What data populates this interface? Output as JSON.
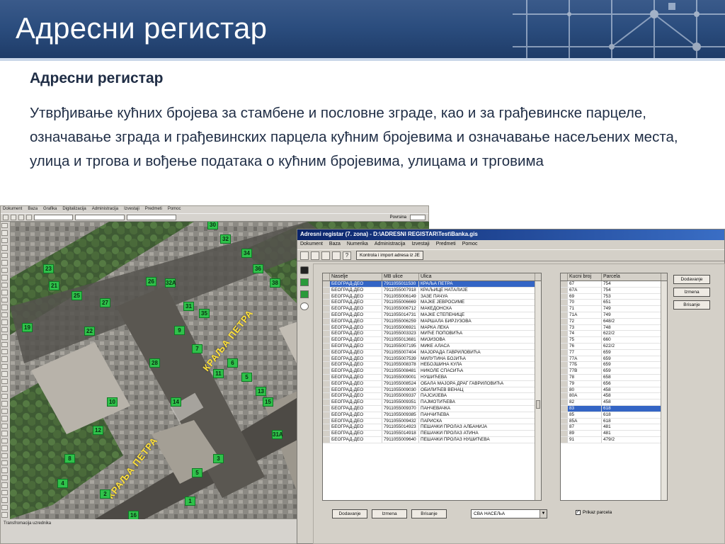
{
  "slide": {
    "title": "Адресни регистар",
    "subheading": "Адресни регистар",
    "body": "Утврђивање кућних бројева за стамбене и пословне зграде, као и за грађевинске парцеле, означавање зграда и грађевинских парцела кућним бројевима и означавање насељених места, улица и тргова и вођење података о кућним бројевима, улицама и трговима"
  },
  "colors": {
    "banner": "#2b4d7e",
    "text": "#1f2d45",
    "building_marker": "#2fc14a",
    "street_label": "#ffe13a",
    "selection": "#3465c5"
  },
  "map_app": {
    "menu": [
      "Dokument",
      "Baza",
      "Grafika",
      "Digitalizacija",
      "Administracija",
      "Izvestaji",
      "Predmeti",
      "Pomoc"
    ],
    "status_text": "Transfromacija uzrednika",
    "zoom_label": "Povrsina",
    "street_labels": [
      "КРАЉА ПЕТРА",
      "КРАЉА ПЕТРА"
    ],
    "building_numbers": [
      "30",
      "32",
      "34",
      "36",
      "38",
      "26",
      "42",
      "44",
      "23",
      "21",
      "25",
      "27",
      "19",
      "22",
      "32A",
      "28",
      "35",
      "31",
      "9",
      "7",
      "6",
      "11",
      "5",
      "13",
      "15",
      "31A",
      "14",
      "3",
      "5",
      "1",
      "10",
      "12",
      "8",
      "4",
      "2",
      "16"
    ]
  },
  "register": {
    "window_title": "Adresni registar (7. zona) - D:\\ADRESNI REGISTAR\\Test\\Banka.gis",
    "menu": [
      "Dokument",
      "Baza",
      "Numerika",
      "Administracija",
      "Izvestaji",
      "Predmeti",
      "Pomoc"
    ],
    "toolbar_button": "Kontrola i import adresa iz JE",
    "streets_table": {
      "headers": [
        "Naselje",
        "MB ulice",
        "Ulica"
      ],
      "selected_index": 0,
      "rows": [
        [
          "БЕОГРАД-ДЕО",
          "7911055011530",
          "КРАЉА ПЕТРА"
        ],
        [
          "БЕОГРАД-ДЕО",
          "7911055007918",
          "КРАЉИЦЕ НАТАЛИЈЕ"
        ],
        [
          "БЕОГРАД-ДЕО",
          "7911055006149",
          "ЗАЗЕ ПАЧУА"
        ],
        [
          "БЕОГРАД-ДЕО",
          "7911055006669",
          "МАЈКЕ ЈЕВРОСИМЕ"
        ],
        [
          "БЕОГРАД-ДЕО",
          "7911055006712",
          "МАКЕДОНСКА"
        ],
        [
          "БЕОГРАД-ДЕО",
          "7911055014731",
          "МАЈКЕ СТЕПЕНИЦЕ"
        ],
        [
          "БЕОГРАД-ДЕО",
          "7911055006259",
          "МАРШАЛА БИРЈУЗОВА"
        ],
        [
          "БЕОГРАД-ДЕО",
          "7911055006921",
          "МАРКА ЛЕКА"
        ],
        [
          "БЕОГРАД-ДЕО",
          "7911055003323",
          "МИЋЕ ПОПОВИЋА"
        ],
        [
          "БЕОГРАД-ДЕО",
          "7911055013681",
          "МИЈИЗОВА"
        ],
        [
          "БЕОГРАД-ДЕО",
          "7911055007195",
          "МИКЕ АЛАСА"
        ],
        [
          "БЕОГРАД-ДЕО",
          "7911055007404",
          "МАЈОРАДА ГАВРИЛОВИЋА"
        ],
        [
          "БЕОГРАД-ДЕО",
          "7911055007539",
          "МИЛУТИНА БОЈИЋА"
        ],
        [
          "БЕОГРАД-ДЕО",
          "7911055008378",
          "НЕБОЈШИНА КУЛА"
        ],
        [
          "БЕОГРАД-ДЕО",
          "7911055008481",
          "НИКОЛЕ СПАСИЋА"
        ],
        [
          "БЕОГРАД-ДЕО",
          "7911055009001",
          "НУШИЋЕВА"
        ],
        [
          "БЕОГРАД-ДЕО",
          "7911055008524",
          "ОБАЛА МАЈОРА ДРАГ ГАВРИЛОВИЋА"
        ],
        [
          "БЕОГРАД-ДЕО",
          "7911055009030",
          "ОБИЛИЋЕВ ВЕНАЦ"
        ],
        [
          "БЕОГРАД-ДЕО",
          "7911055009337",
          "ПАЈСИЈЕВА"
        ],
        [
          "БЕОГРАД-ДЕО",
          "7911055009351",
          "ПАЈМОТИЋЕВА"
        ],
        [
          "БЕОГРАД-ДЕО",
          "7911055009370",
          "ПАНЧЕВАЧКА"
        ],
        [
          "БЕОГРАД-ДЕО",
          "7911055009385",
          "ПАНЧИЋЕВА"
        ],
        [
          "БЕОГРАД-ДЕО",
          "7911055009432",
          "ПАРИСКА"
        ],
        [
          "БЕОГРАД-ДЕО",
          "7911055014923",
          "ПЕШАЧКИ ПРОЛАЗ АЛБАНИЈА"
        ],
        [
          "БЕОГРАД-ДЕО",
          "7911055014918",
          "ПЕШАЧКИ ПРОЛАЗ АТИНА"
        ],
        [
          "БЕОГРАД-ДЕО",
          "7911055009640",
          "ПЕШАЧКИ ПРОЛАЗ НУШИЋЕВА"
        ]
      ]
    },
    "numbers_table": {
      "headers": [
        "Kucni broj",
        "Parcela"
      ],
      "selected_index": 20,
      "rows": [
        [
          "67",
          "754"
        ],
        [
          "67A",
          "754"
        ],
        [
          "69",
          "753"
        ],
        [
          "70",
          "651"
        ],
        [
          "71",
          "749"
        ],
        [
          "71A",
          "749"
        ],
        [
          "72",
          "648/2"
        ],
        [
          "73",
          "748"
        ],
        [
          "74",
          "622/2"
        ],
        [
          "75",
          "660"
        ],
        [
          "76",
          "622/2"
        ],
        [
          "77",
          "659"
        ],
        [
          "77A",
          "659"
        ],
        [
          "77Б",
          "659"
        ],
        [
          "77В",
          "659"
        ],
        [
          "78",
          "658"
        ],
        [
          "79",
          "656"
        ],
        [
          "80",
          "458"
        ],
        [
          "80A",
          "458"
        ],
        [
          "82",
          "458"
        ],
        [
          "83",
          "618"
        ],
        [
          "85",
          "618"
        ],
        [
          "85A",
          "618"
        ],
        [
          "87",
          "481"
        ],
        [
          "89",
          "481"
        ],
        [
          "91",
          "479/2"
        ]
      ]
    },
    "side_buttons": [
      "Dodavanje",
      "Izmena",
      "Brisanje"
    ],
    "bottom_buttons": [
      "Dodavanje",
      "Izmena",
      "Brisanje"
    ],
    "settlement_filter": "СВА НАСЕЉА",
    "show_parcels_label": "Prikaz parcela",
    "show_parcels_checked": true
  }
}
